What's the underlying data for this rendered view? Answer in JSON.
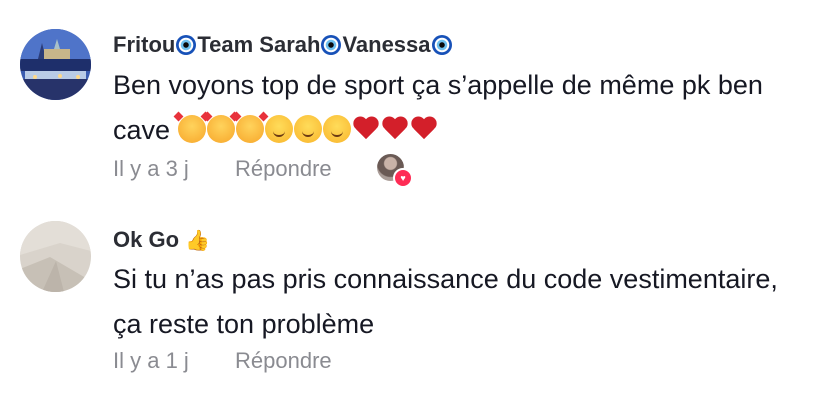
{
  "comments": [
    {
      "author_parts": [
        "Fritou",
        "Team Sarah",
        "Vanessa"
      ],
      "author_icon": "nazar-amulet-icon",
      "text": "Ben voyons top de sport ça s’appelle de même pk ben cave",
      "emojis": [
        "smiling-face-with-hearts",
        "smiling-face-with-hearts",
        "smiling-face-with-hearts",
        "slightly-smiling-face",
        "slightly-smiling-face",
        "slightly-smiling-face",
        "red-heart",
        "red-heart",
        "red-heart"
      ],
      "time": "Il y a 3 j",
      "reply_label": "Répondre",
      "liked_by_creator": true
    },
    {
      "author": "Ok Go",
      "author_emoji": "👍",
      "text": "Si tu n’as pas pris connaissance du code vestimentaire, ça reste ton problème",
      "time": "Il y a 1 j",
      "reply_label": "Répondre"
    }
  ],
  "colors": {
    "author": "#2b2d34",
    "text": "#161823",
    "meta": "#8a8b91",
    "like_badge": "#fe2c55"
  }
}
